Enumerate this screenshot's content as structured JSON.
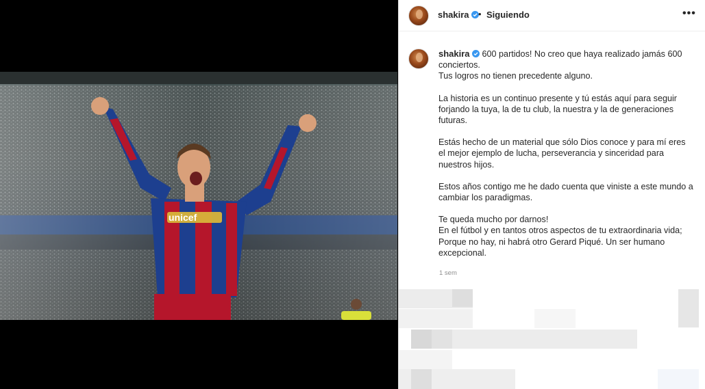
{
  "post": {
    "username": "shakira",
    "follow_status": "Siguiendo",
    "separator": "•",
    "more_glyph": "•••"
  },
  "caption": {
    "username": "shakira",
    "paragraphs": [
      "600 partidos! No creo que haya realizado jamás 600 conciertos.\nTus logros no tienen precedente alguno.",
      "La historia es un continuo presente y tú estás aquí para seguir forjando la tuya, la de tu club, la nuestra y la de generaciones futuras.",
      "Estás hecho de un material que sólo Dios conoce y para mí eres el mejor ejemplo de lucha, perseverancia y sinceridad para nuestros hijos.",
      "Estos años contigo me he dado cuenta que viniste a este mundo a cambiar los paradigmas.",
      "Te queda mucho por darnos!\nEn el fútbol y en tantos otros aspectos de tu extraordinaria vida; Porque no hay, ni habrá otro Gerard Piqué. Un ser humano excepcional."
    ],
    "time_ago": "1 sem"
  },
  "media": {
    "jersey_sponsor": "unicef"
  },
  "colors": {
    "verified_blue": "#3897f0",
    "text": "#262626",
    "muted": "#8e8e8e",
    "barca_blue": "#1d3f8f",
    "barca_red": "#b5162b"
  }
}
